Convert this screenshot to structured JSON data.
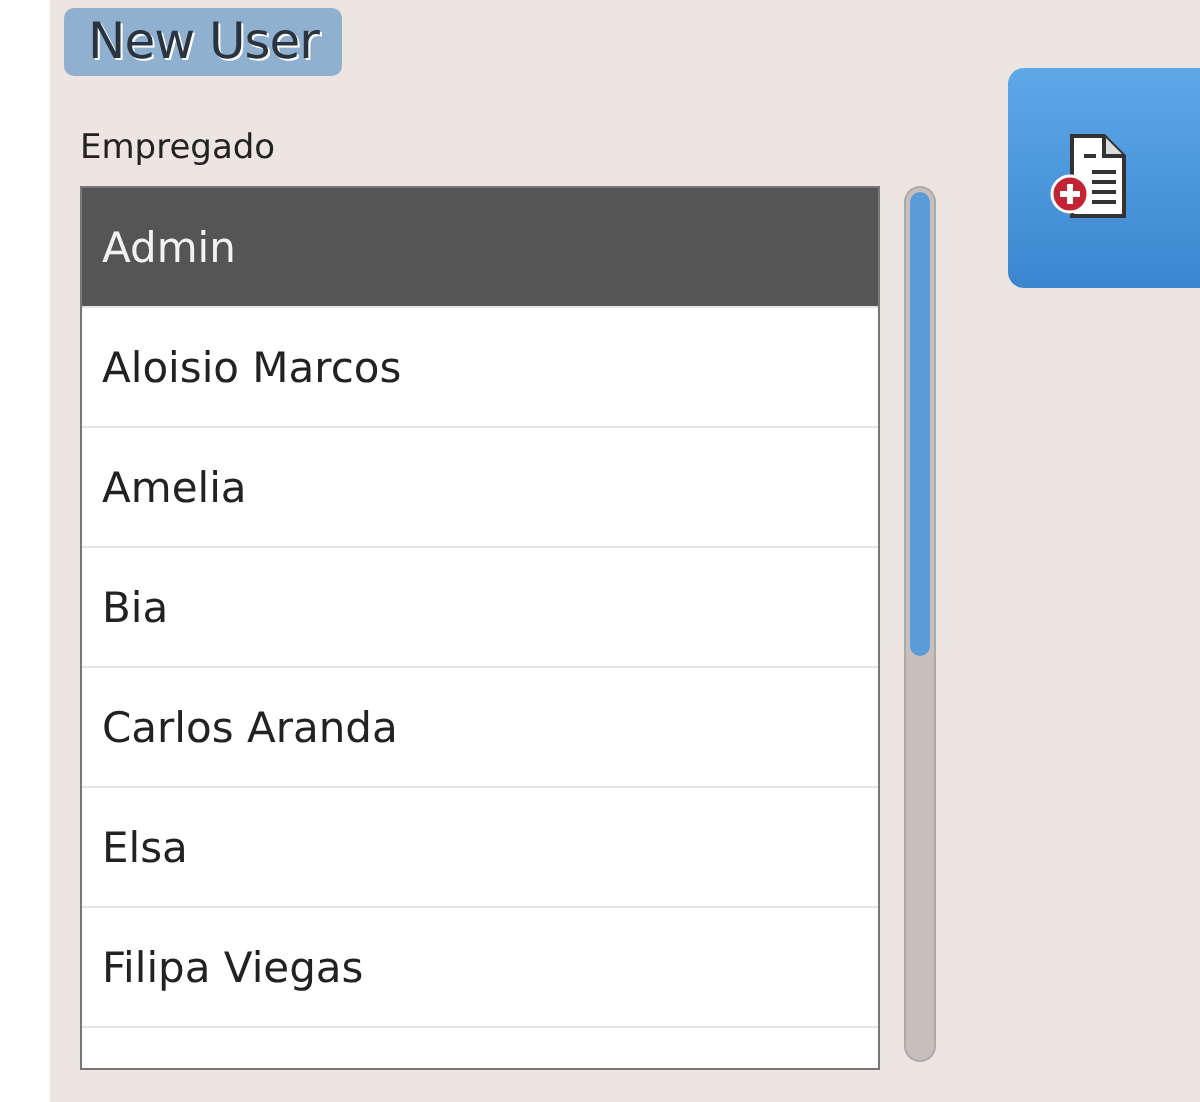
{
  "title": "New User",
  "employee_list": {
    "label": "Empregado",
    "items": [
      {
        "name": "Admin",
        "selected": true
      },
      {
        "name": "Aloisio Marcos",
        "selected": false
      },
      {
        "name": "Amelia",
        "selected": false
      },
      {
        "name": "Bia",
        "selected": false
      },
      {
        "name": "Carlos Aranda",
        "selected": false
      },
      {
        "name": "Elsa",
        "selected": false
      },
      {
        "name": "Filipa Viegas",
        "selected": false
      }
    ]
  }
}
